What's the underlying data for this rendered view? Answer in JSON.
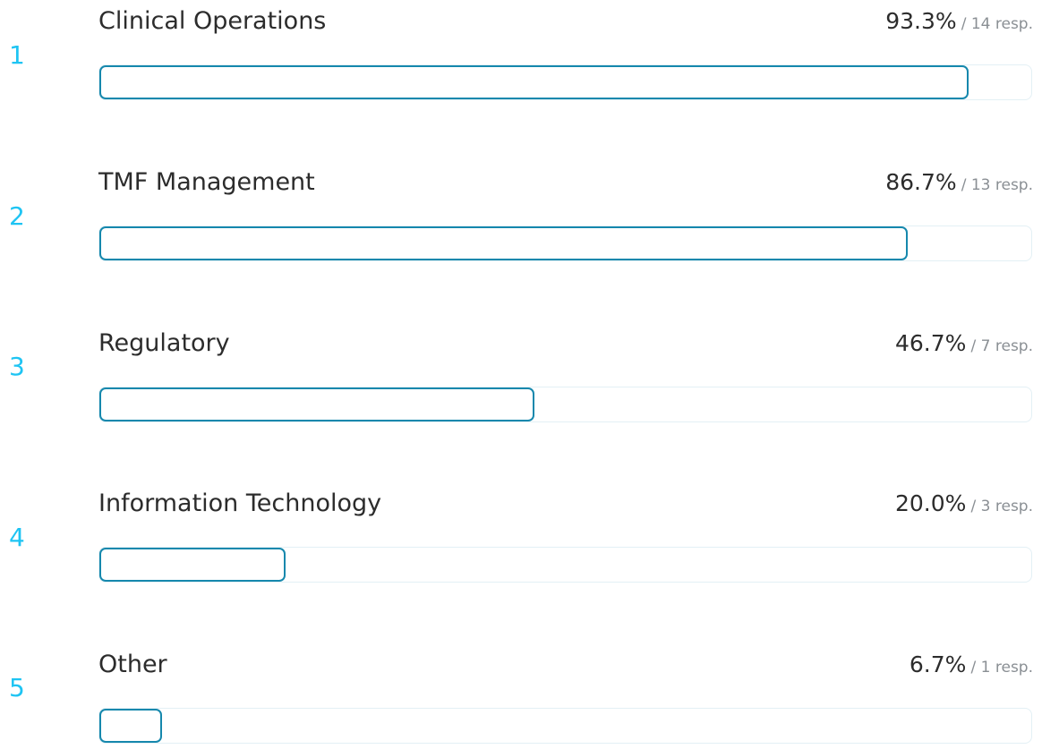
{
  "chart_data": {
    "type": "bar",
    "orientation": "horizontal",
    "categories": [
      "Clinical Operations",
      "TMF Management",
      "Regulatory",
      "Information Technology",
      "Other"
    ],
    "ranks": [
      "1",
      "2",
      "3",
      "4",
      "5"
    ],
    "values": [
      93.3,
      86.7,
      46.7,
      20.0,
      6.7
    ],
    "value_labels": [
      "93.3%",
      "86.7%",
      "46.7%",
      "20.0%",
      "6.7%"
    ],
    "responses": [
      14,
      13,
      7,
      3,
      1
    ],
    "response_labels": [
      "/ 14 resp.",
      "/ 13 resp.",
      "/ 7 resp.",
      "/ 3 resp.",
      "/ 1 resp."
    ],
    "xlim": [
      0,
      100
    ],
    "grid": false,
    "colors": {
      "rank": "#1ec4f3",
      "bar_border": "#1688ad",
      "track_border": "#e3f0f5",
      "label": "#2c2c2c",
      "response": "#8a8f94"
    }
  }
}
